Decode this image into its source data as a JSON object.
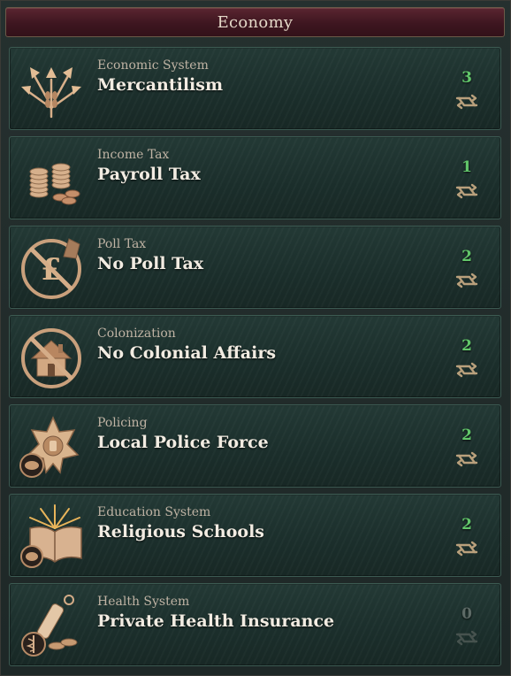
{
  "header": {
    "title": "Economy"
  },
  "colors": {
    "header_bg": "#3e1620",
    "card_bg": "#1b2e2b",
    "cost_positive": "#62c76a",
    "cost_zero": "#5d6a66",
    "copper": "#c79a72"
  },
  "laws": [
    {
      "category": "Economic System",
      "law": "Mercantilism",
      "cost": "3",
      "icon": "wheat-arrows-icon",
      "swap_enabled": true
    },
    {
      "category": "Income Tax",
      "law": "Payroll Tax",
      "cost": "1",
      "icon": "coins-icon",
      "swap_enabled": true
    },
    {
      "category": "Poll Tax",
      "law": "No Poll Tax",
      "cost": "2",
      "icon": "no-pound-icon",
      "swap_enabled": true
    },
    {
      "category": "Colonization",
      "law": "No Colonial Affairs",
      "cost": "2",
      "icon": "no-house-icon",
      "swap_enabled": true
    },
    {
      "category": "Policing",
      "law": "Local Police Force",
      "cost": "2",
      "icon": "police-badge-icon",
      "swap_enabled": true
    },
    {
      "category": "Education System",
      "law": "Religious Schools",
      "cost": "2",
      "icon": "open-book-icon",
      "swap_enabled": true
    },
    {
      "category": "Health System",
      "law": "Private Health Insurance",
      "cost": "0",
      "icon": "caduceus-icon",
      "swap_enabled": false
    }
  ]
}
